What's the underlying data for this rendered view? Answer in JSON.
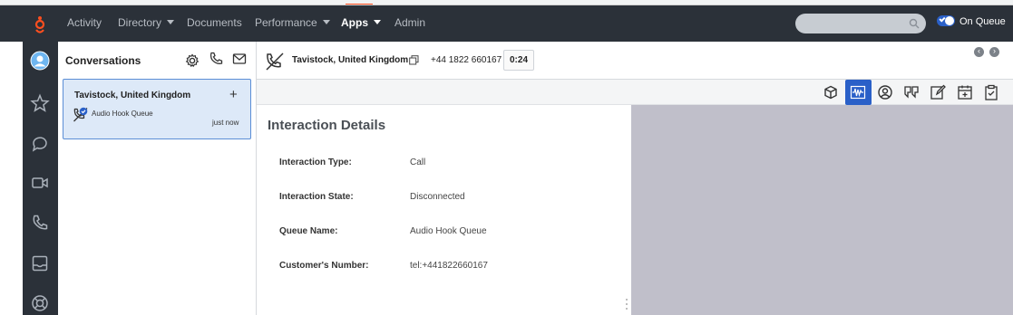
{
  "nav": {
    "items": [
      {
        "label": "Activity",
        "has_caret": false
      },
      {
        "label": "Directory",
        "has_caret": true
      },
      {
        "label": "Documents",
        "has_caret": false
      },
      {
        "label": "Performance",
        "has_caret": true
      },
      {
        "label": "Apps",
        "has_caret": true,
        "active": true
      },
      {
        "label": "Admin",
        "has_caret": false
      }
    ],
    "search": {
      "placeholder": ""
    },
    "queue_status": "On Queue"
  },
  "rail": {
    "icons": [
      "avatar",
      "star-icon",
      "chat-icon",
      "video-icon",
      "phone-icon",
      "inbox-icon",
      "help-icon"
    ]
  },
  "conversations": {
    "title": "Conversations",
    "card": {
      "title": "Tavistock, United Kingdom",
      "queue": "Audio Hook Queue",
      "time": "just now"
    }
  },
  "interaction": {
    "name": "Tavistock, United Kingdom",
    "phone": "+44 1822 660167",
    "timer": "0:24"
  },
  "details": {
    "title": "Interaction Details",
    "rows": [
      {
        "label": "Interaction Type:",
        "value": "Call"
      },
      {
        "label": "Interaction State:",
        "value": "Disconnected"
      },
      {
        "label": "Queue Name:",
        "value": "Audio Hook Queue"
      },
      {
        "label": "Customer's Number:",
        "value": "tel:+441822660167"
      }
    ]
  },
  "colors": {
    "nav_bg": "#2b3139",
    "accent": "#2a60c8",
    "card_bg": "#dde9f8",
    "grey_pane": "#c0bfca"
  }
}
